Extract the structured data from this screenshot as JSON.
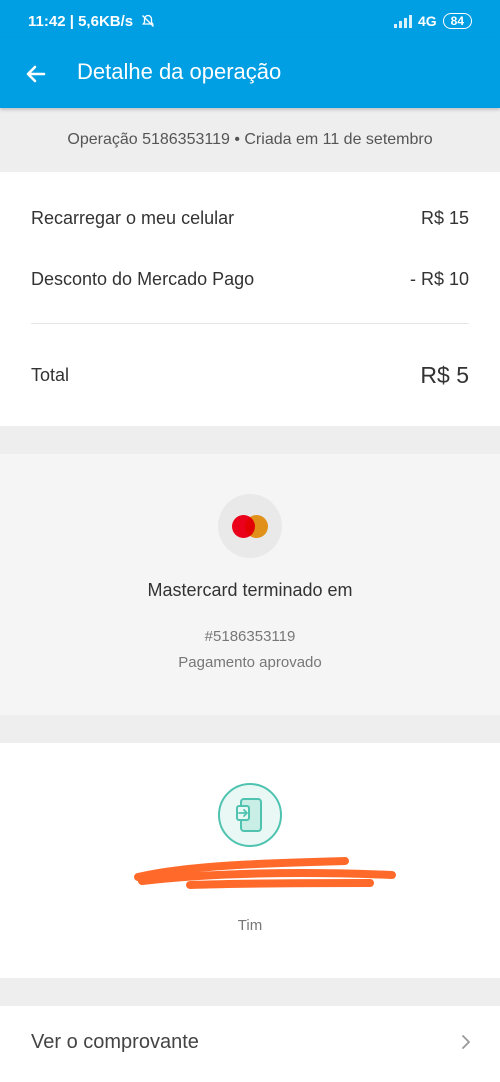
{
  "status_bar": {
    "time": "11:42",
    "speed": "5,6KB/s",
    "network": "4G",
    "battery": "84"
  },
  "app_bar": {
    "title": "Detalhe da operação",
    "back_icon": "arrow-left-icon",
    "color": "#009ee3"
  },
  "operation": {
    "header": "Operação 5186353119 • Criada em 11 de setembro"
  },
  "summary": {
    "items": [
      {
        "label": "Recarregar o meu celular",
        "amount": "R$ 15"
      },
      {
        "label": "Desconto do Mercado Pago",
        "amount": "- R$ 10"
      }
    ],
    "total_label": "Total",
    "total_amount": "R$ 5"
  },
  "payment": {
    "card_icon": "mastercard-icon",
    "card_label": "Mastercard terminado em",
    "op_number": "#5186353119",
    "status": "Pagamento aprovado"
  },
  "recharge": {
    "icon": "phone-recharge-icon",
    "carrier": "Tim"
  },
  "receipt": {
    "label": "Ver o comprovante",
    "chevron_icon": "chevron-right-icon"
  }
}
